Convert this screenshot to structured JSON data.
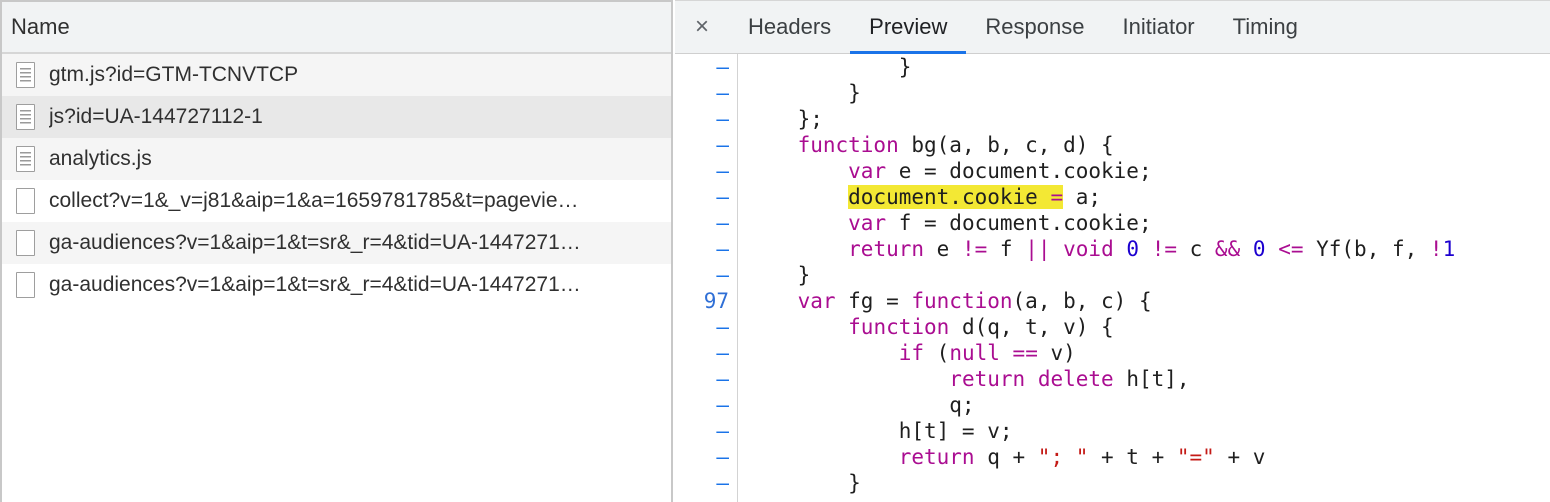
{
  "request_list": {
    "header": "Name",
    "items": [
      {
        "name": "gtm.js?id=GTM-TCNVTCP",
        "icon": "script-file-icon"
      },
      {
        "name": "js?id=UA-144727112-1",
        "icon": "script-file-icon"
      },
      {
        "name": "analytics.js",
        "icon": "script-file-icon"
      },
      {
        "name": "collect?v=1&_v=j81&aip=1&a=1659781785&t=pagevie…",
        "icon": "blank-file-icon"
      },
      {
        "name": "ga-audiences?v=1&aip=1&t=sr&_r=4&tid=UA-1447271…",
        "icon": "blank-file-icon"
      },
      {
        "name": "ga-audiences?v=1&aip=1&t=sr&_r=4&tid=UA-1447271…",
        "icon": "blank-file-icon"
      }
    ]
  },
  "tabs": {
    "close": "×",
    "items": [
      "Headers",
      "Preview",
      "Response",
      "Initiator",
      "Timing"
    ],
    "active": "Preview"
  },
  "gutter": [
    "–",
    "–",
    "–",
    "–",
    "–",
    "–",
    "–",
    "–",
    "–",
    "97",
    "–",
    "–",
    "–",
    "–",
    "–",
    "–",
    "–"
  ],
  "code_lines": [
    "            }",
    "        }",
    "    };",
    "    function bg(a, b, c, d) {",
    "        var e = document.cookie;",
    "        document.cookie = a;",
    "        var f = document.cookie;",
    "        return e != f || void 0 != c && 0 <= Yf(b, f, !1",
    "    }",
    "    var fg = function(a, b, c) {",
    "        function d(q, t, v) {",
    "            if (null == v)",
    "                return delete h[t],",
    "                q;",
    "            h[t] = v;",
    "            return q + \"; \" + t + \"=\" + v",
    "        }"
  ],
  "highlight": "document.cookie =",
  "colors": {
    "keyword": "#aa0d91",
    "number": "#1c00cf",
    "string": "#c41a16",
    "highlight": "#f3e834",
    "tab_active_underline": "#1a73e8"
  }
}
